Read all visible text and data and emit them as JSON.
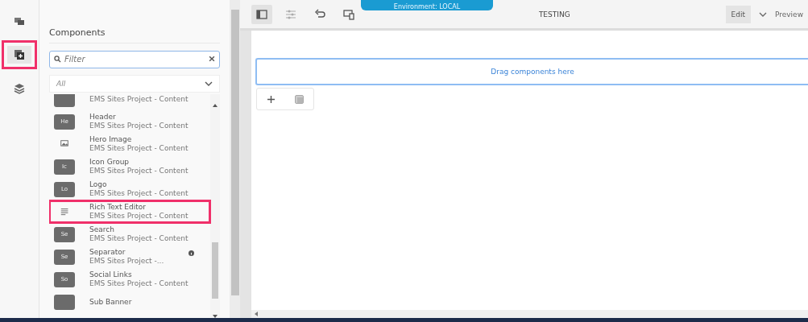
{
  "rail": [
    {
      "kind": "images",
      "selected": false,
      "highlighted": false
    },
    {
      "kind": "add",
      "selected": true,
      "highlighted": true
    },
    {
      "kind": "layers",
      "selected": false,
      "highlighted": false
    }
  ],
  "panel": {
    "title": "Components",
    "filter": {
      "placeholder": "Filter"
    },
    "group_select": {
      "value": "All"
    },
    "components": [
      {
        "kind": "badge",
        "subtitle": "EMS Sites Project - Content",
        "highlighted": false,
        "info": false
      },
      {
        "kind": "badge",
        "badge": "He",
        "title": "Header",
        "subtitle": "EMS Sites Project - Content",
        "highlighted": false,
        "info": false
      },
      {
        "kind": "image",
        "title": "Hero Image",
        "subtitle": "EMS Sites Project - Content",
        "highlighted": false,
        "info": false
      },
      {
        "kind": "badge",
        "badge": "Ic",
        "title": "Icon Group",
        "subtitle": "EMS Sites Project - Content",
        "highlighted": false,
        "info": false
      },
      {
        "kind": "badge",
        "badge": "Lo",
        "title": "Logo",
        "subtitle": "EMS Sites Project - Content",
        "highlighted": false,
        "info": false
      },
      {
        "kind": "lines",
        "title": "Rich Text Editor",
        "subtitle": "EMS Sites Project - Content",
        "highlighted": true,
        "info": false
      },
      {
        "kind": "badge",
        "badge": "Se",
        "title": "Search",
        "subtitle": "EMS Sites Project - Content",
        "highlighted": false,
        "info": false
      },
      {
        "kind": "badge",
        "badge": "Se",
        "title": "Separator",
        "subtitle": "EMS Sites Project -...",
        "highlighted": false,
        "info": true
      },
      {
        "kind": "badge",
        "badge": "So",
        "title": "Social Links",
        "subtitle": "EMS Sites Project - Content",
        "highlighted": false,
        "info": false
      },
      {
        "kind": "badge",
        "title": "Sub Banner",
        "highlighted": false,
        "info": false
      }
    ]
  },
  "toolbar": {
    "environment": "Environment: LOCAL",
    "page_title": "TESTING",
    "mode": "Edit",
    "preview": "Preview"
  },
  "canvas": {
    "drop_zone": "Drag components here"
  }
}
